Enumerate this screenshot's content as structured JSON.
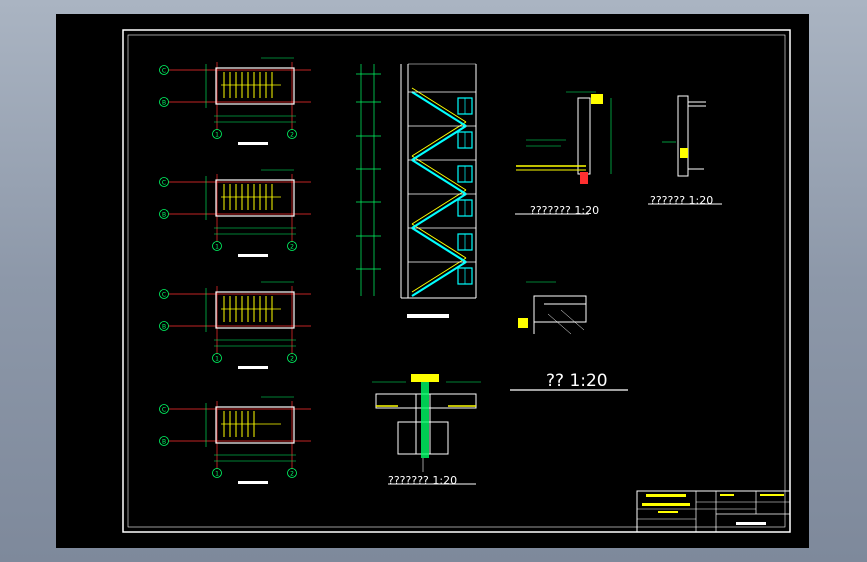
{
  "colors": {
    "background": "#000000",
    "frame": "#ffffff",
    "grid_axis": "#ff3030",
    "wall": "#ffffff",
    "stair": "#ffff00",
    "dimension": "#00ff66",
    "railing": "#00ffff",
    "rebar": "#ff3030",
    "title_text": "#ffffff"
  },
  "detail_titles": {
    "stair_section": "??????? 1:20",
    "railing_detail": "?????? 1:20",
    "step_detail": "?? 1:20",
    "foundation_detail": "??????? 1:20"
  },
  "plans": [
    {
      "axis_top": "C",
      "axis_bottom": "B",
      "axis_left": "1",
      "axis_right": "2"
    },
    {
      "axis_top": "C",
      "axis_bottom": "B",
      "axis_left": "1",
      "axis_right": "2"
    },
    {
      "axis_top": "C",
      "axis_bottom": "B",
      "axis_left": "1",
      "axis_right": "2"
    },
    {
      "axis_top": "C",
      "axis_bottom": "B",
      "axis_left": "1",
      "axis_right": "2"
    }
  ]
}
